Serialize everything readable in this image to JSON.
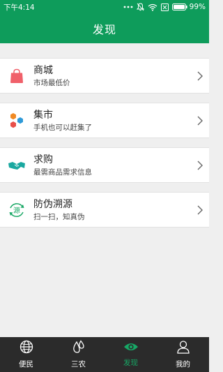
{
  "status_bar": {
    "time": "下午4:14",
    "battery": "99%"
  },
  "header": {
    "title": "发现"
  },
  "items": [
    {
      "title": "商城",
      "subtitle": "市场最低价",
      "icon": "shopping-bag-icon"
    },
    {
      "title": "集市",
      "subtitle": "手机也可以赶集了",
      "icon": "hexagon-cluster-icon"
    },
    {
      "title": "求购",
      "subtitle": "最需商品需求信息",
      "icon": "handshake-icon"
    },
    {
      "title": "防伪溯源",
      "subtitle": "扫一扫，知真伪",
      "icon": "source-trace-icon",
      "icon_text": "源"
    }
  ],
  "tabs": [
    {
      "label": "便民",
      "icon": "globe-icon"
    },
    {
      "label": "三农",
      "icon": "water-drops-icon"
    },
    {
      "label": "发现",
      "icon": "eye-icon",
      "active": true
    },
    {
      "label": "我的",
      "icon": "person-icon"
    }
  ],
  "colors": {
    "brand": "#0e9c5b",
    "tab_active": "#17a866",
    "tab_bar": "#2b2b2b"
  }
}
